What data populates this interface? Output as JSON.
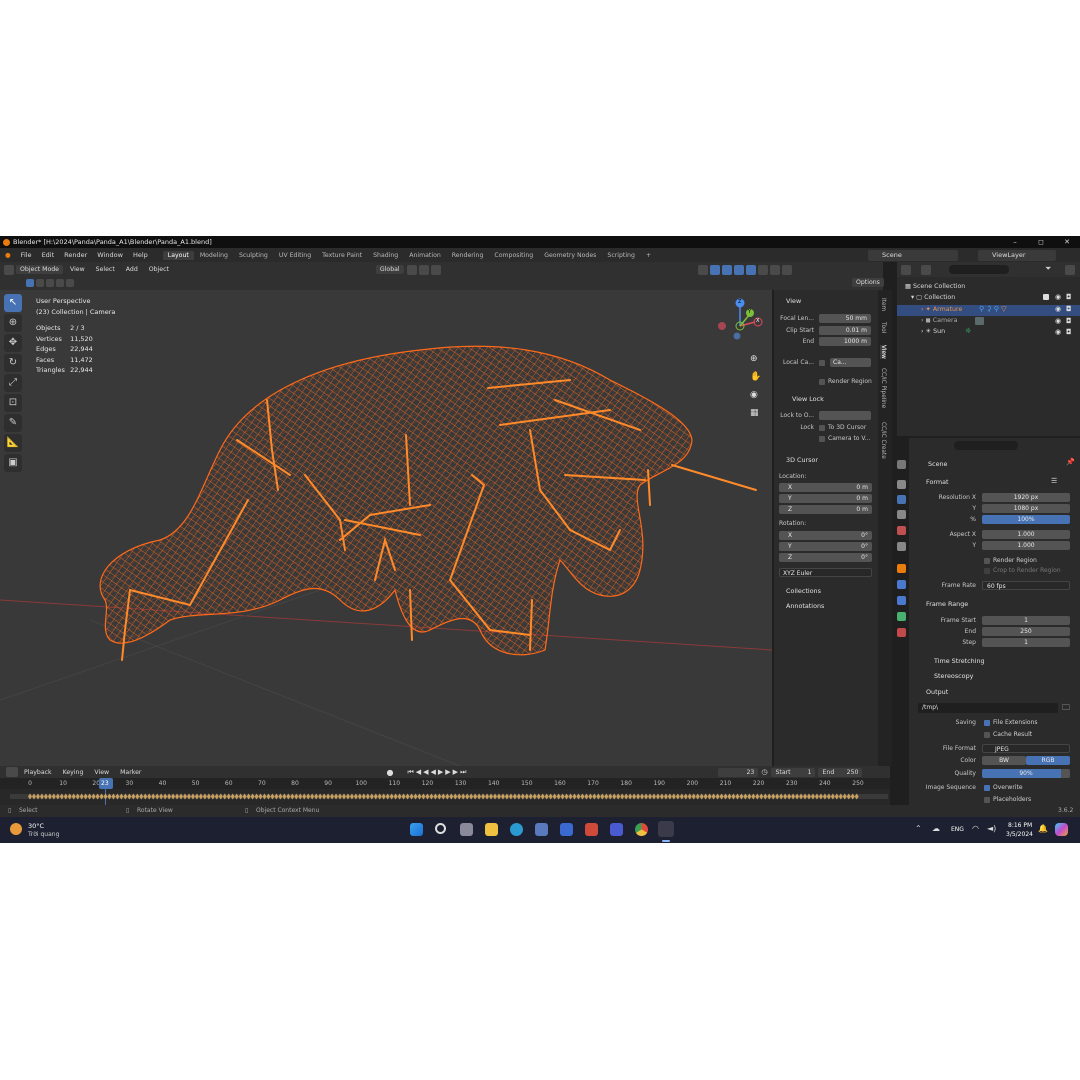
{
  "window": {
    "title": "Blender* [H:\\2024\\Panda\\Panda_A1\\Blender\\Panda_A1.blend]",
    "min": "–",
    "max": "◻",
    "close": "✕"
  },
  "menu": [
    "File",
    "Edit",
    "Render",
    "Window",
    "Help"
  ],
  "workspaces": [
    "Layout",
    "Modeling",
    "Sculpting",
    "UV Editing",
    "Texture Paint",
    "Shading",
    "Animation",
    "Rendering",
    "Compositing",
    "Geometry Nodes",
    "Scripting"
  ],
  "workspace_add": "+",
  "scene_name": "Scene",
  "view_layer": "ViewLayer",
  "header": {
    "mode": "Object Mode",
    "view": "View",
    "select": "Select",
    "add": "Add",
    "object": "Object",
    "orientation": "Global",
    "options": "Options"
  },
  "overlay": {
    "perspective": "User Perspective",
    "collection": "(23) Collection | Camera"
  },
  "stats": [
    {
      "k": "Objects",
      "v": "2 / 3"
    },
    {
      "k": "Vertices",
      "v": "11,520"
    },
    {
      "k": "Edges",
      "v": "22,944"
    },
    {
      "k": "Faces",
      "v": "11,472"
    },
    {
      "k": "Triangles",
      "v": "22,944"
    }
  ],
  "gizmo": {
    "x": "X",
    "y": "Y",
    "z": "Z"
  },
  "npanel": {
    "view_title": "View",
    "focal_label": "Focal Len...",
    "focal": "50 mm",
    "clip_start_label": "Clip Start",
    "clip_start": "0.01 m",
    "clip_end_label": "End",
    "clip_end": "1000 m",
    "local_camera_label": "Local Ca...",
    "local_camera": "Ca...",
    "render_region": "Render Region",
    "view_lock_title": "View Lock",
    "lock_to_object_label": "Lock to O...",
    "lock_label": "Lock",
    "to_3d_cursor": "To 3D Cursor",
    "camera_to_view": "Camera to V...",
    "cursor_title": "3D Cursor",
    "location_label": "Location:",
    "loc": [
      {
        "k": "X",
        "v": "0 m"
      },
      {
        "k": "Y",
        "v": "0 m"
      },
      {
        "k": "Z",
        "v": "0 m"
      }
    ],
    "rotation_label": "Rotation:",
    "rot": [
      {
        "k": "X",
        "v": "0°"
      },
      {
        "k": "Y",
        "v": "0°"
      },
      {
        "k": "Z",
        "v": "0°"
      }
    ],
    "rotation_mode": "XYZ Euler",
    "collections": "Collections",
    "annotations": "Annotations"
  },
  "vtabs": [
    "Item",
    "Tool",
    "View",
    "CC/iC Pipeline",
    "CC/iC Create"
  ],
  "outliner": {
    "root": "Scene Collection",
    "collection": "Collection",
    "items": [
      {
        "name": "Armature",
        "color": "#e8944a"
      },
      {
        "name": "Camera",
        "color": "#aaaaaa"
      },
      {
        "name": "Sun",
        "color": "#d8d8d8"
      }
    ]
  },
  "properties": {
    "context": "Scene",
    "format_title": "Format",
    "res_x_label": "Resolution X",
    "res_x": "1920 px",
    "res_y_label": "Y",
    "res_y": "1080 px",
    "res_pct_label": "%",
    "res_pct": "100%",
    "aspect_x_label": "Aspect X",
    "aspect_x": "1.000",
    "aspect_y_label": "Y",
    "aspect_y": "1.000",
    "render_region": "Render Region",
    "crop": "Crop to Render Region",
    "frame_rate_label": "Frame Rate",
    "frame_rate": "60 fps",
    "frame_range_title": "Frame Range",
    "frame_start_label": "Frame Start",
    "frame_start": "1",
    "frame_end_label": "End",
    "frame_end": "250",
    "step_label": "Step",
    "step": "1",
    "time_stretching": "Time Stretching",
    "stereoscopy": "Stereoscopy",
    "output_title": "Output",
    "output_path": "/tmp\\",
    "saving_label": "Saving",
    "file_extensions": "File Extensions",
    "cache_result": "Cache Result",
    "file_format_label": "File Format",
    "file_format": "JPEG",
    "color_label": "Color",
    "color_bw": "BW",
    "color_rgb": "RGB",
    "quality_label": "Quality",
    "quality": "90%",
    "image_sequence_label": "Image Sequence",
    "overwrite": "Overwrite",
    "placeholders": "Placeholders"
  },
  "timeline": {
    "playback": "Playback",
    "keying": "Keying",
    "view": "View",
    "marker": "Marker",
    "current": "23",
    "start_label": "Start",
    "start": "1",
    "end_label": "End",
    "end": "250",
    "ticks": [
      "0",
      "10",
      "20",
      "23",
      "30",
      "40",
      "50",
      "60",
      "70",
      "80",
      "90",
      "100",
      "110",
      "120",
      "130",
      "140",
      "150",
      "160",
      "170",
      "180",
      "190",
      "200",
      "210",
      "220",
      "230",
      "240",
      "250"
    ]
  },
  "status": {
    "select": "Select",
    "rotate": "Rotate View",
    "context": "Object Context Menu",
    "version": "3.6.2"
  },
  "taskbar": {
    "temp": "30°C",
    "weather": "Trời quang",
    "lang": "ENG",
    "time": "8:16 PM",
    "date": "3/5/2024"
  },
  "colors": {
    "accent": "#4772b3",
    "wire": "#ff6a1a",
    "bone": "#ff8a2a"
  }
}
